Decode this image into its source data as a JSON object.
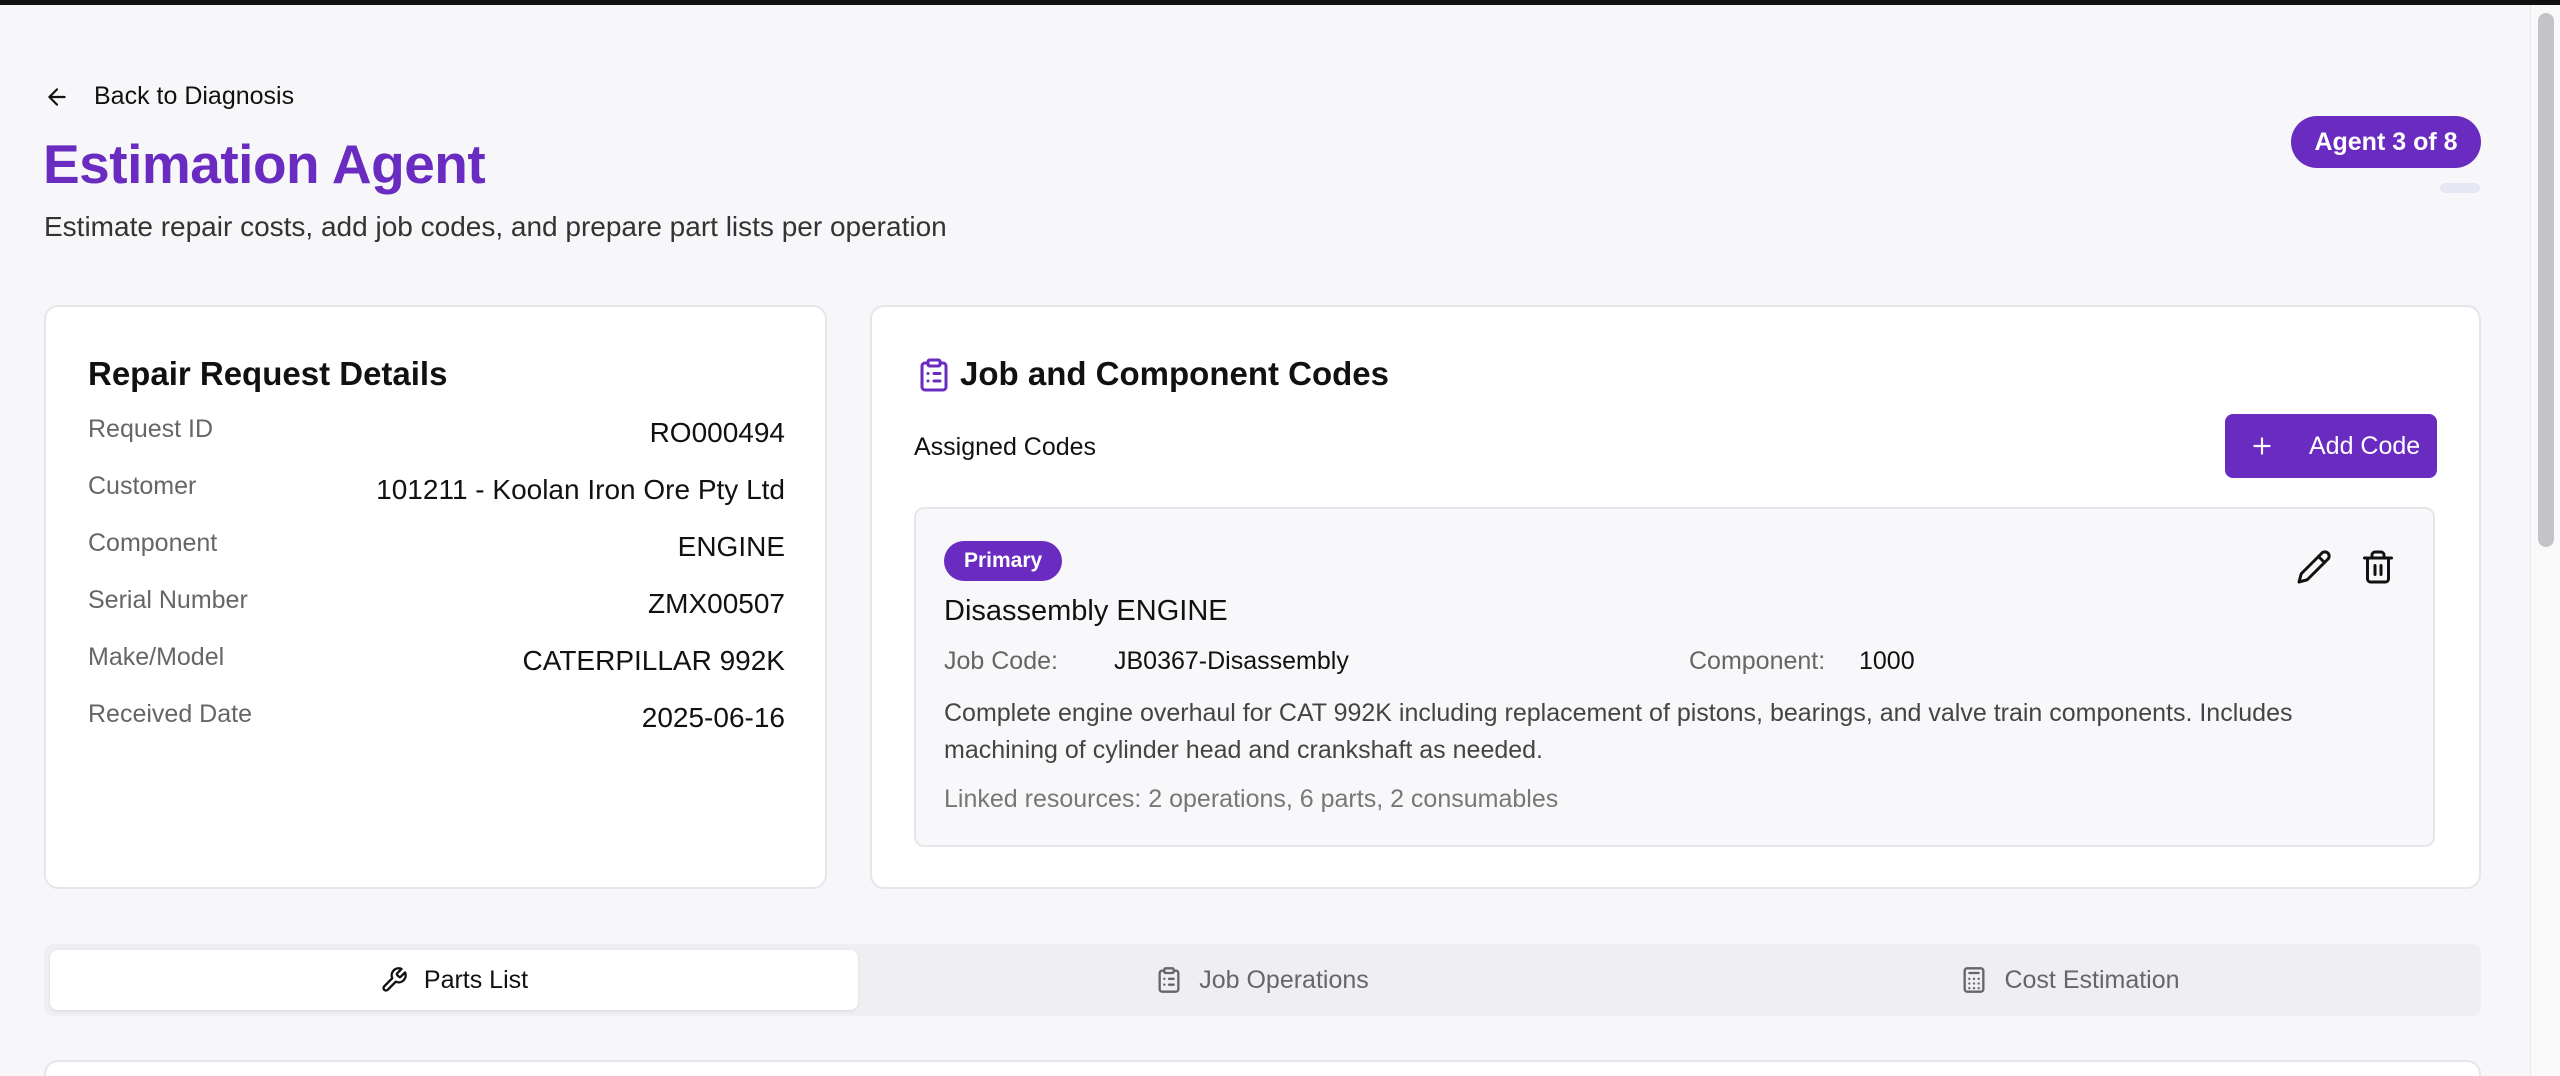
{
  "header": {
    "back_label": "Back to Diagnosis",
    "title": "Estimation Agent",
    "subtitle": "Estimate repair costs, add job codes, and prepare part lists per operation",
    "agent_badge": "Agent 3 of 8"
  },
  "details": {
    "heading": "Repair Request Details",
    "rows": [
      {
        "label": "Request ID",
        "value": "RO000494"
      },
      {
        "label": "Customer",
        "value": "101211 - Koolan Iron Ore Pty Ltd"
      },
      {
        "label": "Component",
        "value": "ENGINE"
      },
      {
        "label": "Serial Number",
        "value": "ZMX00507"
      },
      {
        "label": "Make/Model",
        "value": "CATERPILLAR 992K"
      },
      {
        "label": "Received Date",
        "value": "2025-06-16"
      }
    ]
  },
  "codes": {
    "heading": "Job and Component Codes",
    "assigned_label": "Assigned Codes",
    "add_label": "Add Code",
    "item": {
      "badge": "Primary",
      "title": "Disassembly ENGINE",
      "job_code_label": "Job Code:",
      "job_code_value": "JB0367-Disassembly",
      "component_label": "Component:",
      "component_value": "1000",
      "description": "Complete engine overhaul for CAT 992K including replacement of pistons, bearings, and valve train components. Includes machining of cylinder head and crankshaft as needed.",
      "linked": "Linked resources: 2 operations, 6 parts, 2 consumables"
    }
  },
  "tabs": [
    {
      "label": "Parts List",
      "icon": "wrench-icon",
      "active": true
    },
    {
      "label": "Job Operations",
      "icon": "clipboard-icon",
      "active": false
    },
    {
      "label": "Cost Estimation",
      "icon": "calculator-icon",
      "active": false
    }
  ],
  "colors": {
    "accent": "#6a2bc0",
    "background": "#f7f7fa"
  }
}
